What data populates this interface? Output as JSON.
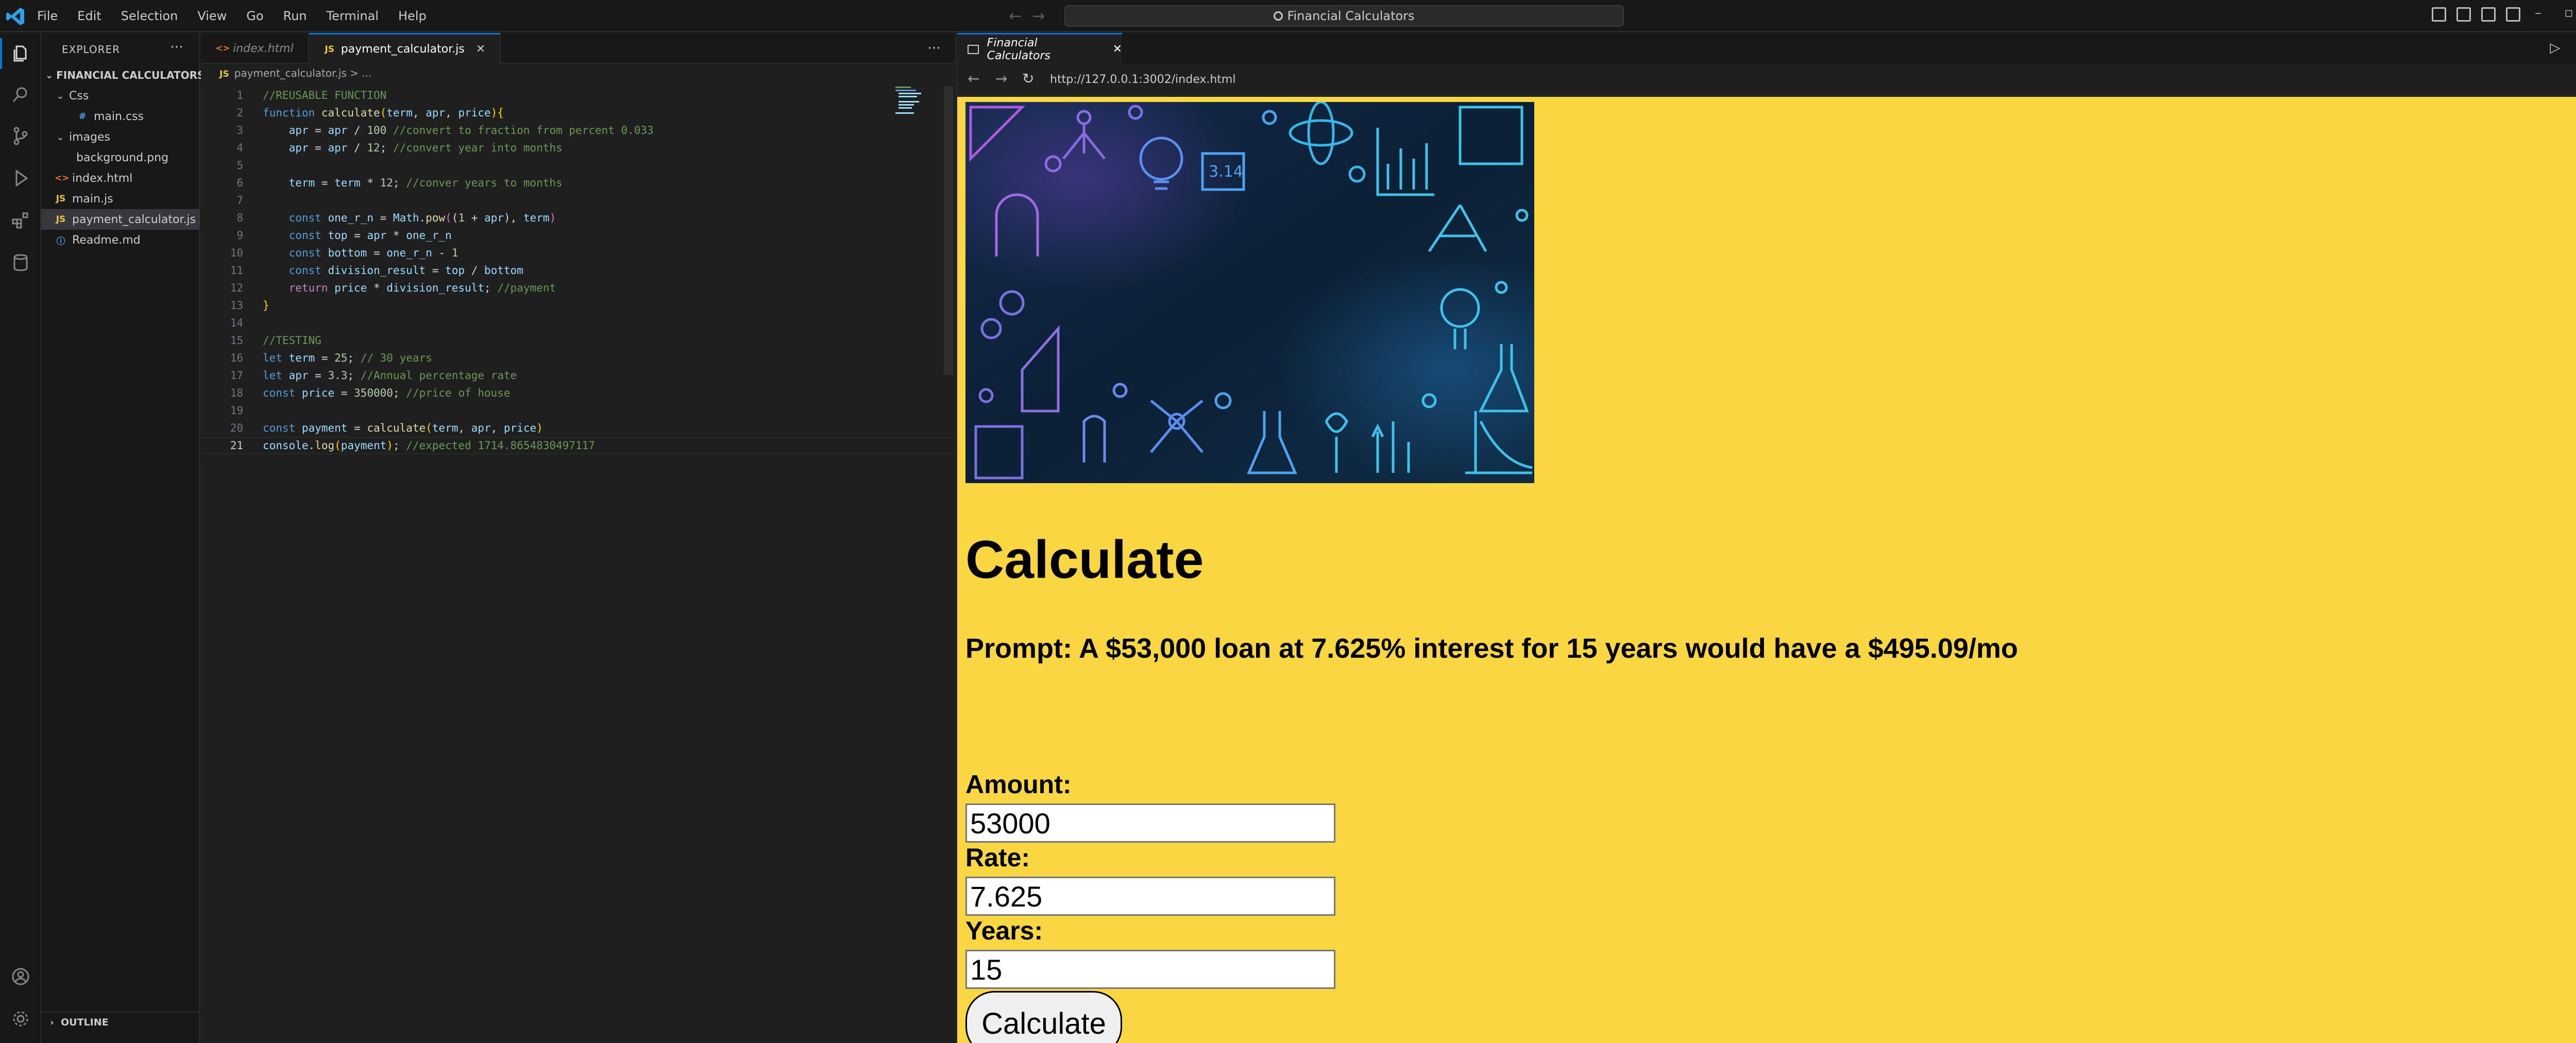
{
  "titlebar": {
    "menu": [
      "File",
      "Edit",
      "Selection",
      "View",
      "Go",
      "Run",
      "Terminal",
      "Help"
    ],
    "search": "Financial Calculators"
  },
  "sidebar": {
    "title": "EXPLORER",
    "project": "FINANCIAL CALCULATORS",
    "folders": {
      "css": "Css",
      "images": "images"
    },
    "files": {
      "main_css": "main.css",
      "background_png": "background.png",
      "index_html": "index.html",
      "main_js": "main.js",
      "payment_calculator_js": "payment_calculator.js",
      "readme_md": "Readme.md"
    },
    "outline": "OUTLINE"
  },
  "editor": {
    "tabs": [
      "index.html",
      "payment_calculator.js"
    ],
    "breadcrumb": "payment_calculator.js > ...",
    "line_numbers": [
      "1",
      "2",
      "3",
      "4",
      "5",
      "6",
      "7",
      "8",
      "9",
      "10",
      "11",
      "12",
      "13",
      "14",
      "15",
      "16",
      "17",
      "18",
      "19",
      "20",
      "21"
    ]
  },
  "browser": {
    "tab_title": "Financial Calculators",
    "url": "http://127.0.0.1:3002/index.html",
    "page": {
      "heading": "Calculate",
      "prompt": "Prompt: A $53,000 loan at 7.625% interest for 15 years would have a $495.09/mo",
      "amount_label": "Amount:",
      "amount_value": "53000",
      "rate_label": "Rate:",
      "rate_value": "7.625",
      "years_label": "Years:",
      "years_value": "15",
      "button": "Calculate"
    }
  },
  "colors": {
    "accent": "#0078d4",
    "page_background": "#fad642"
  }
}
